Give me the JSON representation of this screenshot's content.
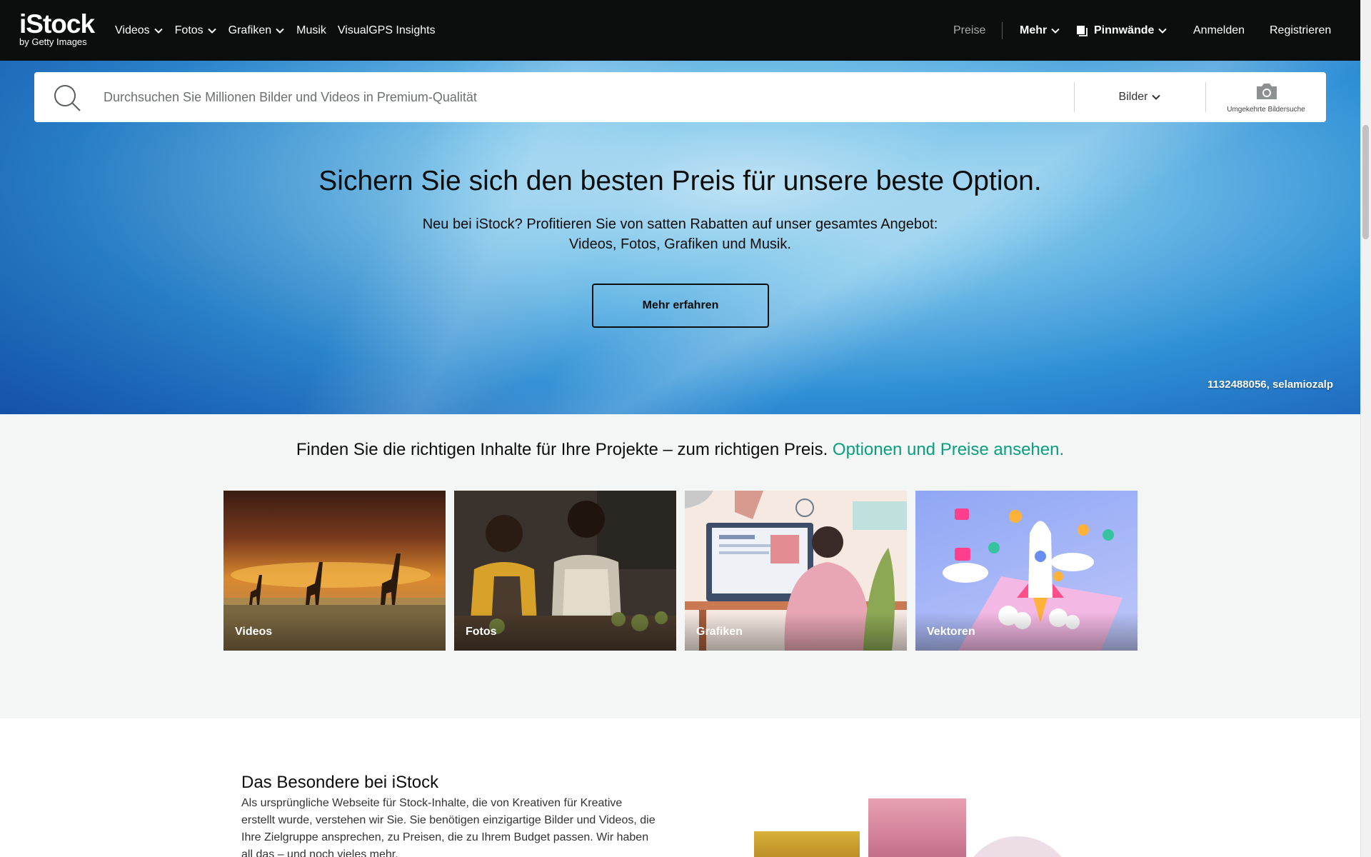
{
  "nav": {
    "logo": "iStock",
    "logo_sub": "by Getty Images",
    "left_items": [
      {
        "label": "Videos",
        "dropdown": true
      },
      {
        "label": "Fotos",
        "dropdown": true
      },
      {
        "label": "Grafiken",
        "dropdown": true
      },
      {
        "label": "Musik",
        "dropdown": false
      },
      {
        "label": "VisualGPS Insights",
        "dropdown": false
      }
    ],
    "preise": "Preise",
    "mehr": "Mehr",
    "pinnwaende": "Pinnwände",
    "anmelden": "Anmelden",
    "registrieren": "Registrieren"
  },
  "search": {
    "placeholder": "Durchsuchen Sie Millionen Bilder und Videos in Premium-Qualität",
    "type": "Bilder",
    "reverse_search": "Umgekehrte Bildersuche"
  },
  "hero": {
    "title": "Sichern Sie sich den besten Preis für unsere beste Option.",
    "subtitle_line1": "Neu bei iStock? Profitieren Sie von satten Rabatten auf unser gesamtes Angebot:",
    "subtitle_line2": "Videos, Fotos, Grafiken und Musik.",
    "button": "Mehr erfahren",
    "credit": "1132488056, selamiozalp"
  },
  "categories": {
    "intro": "Finden Sie die richtigen Inhalte für Ihre Projekte – zum richtigen Preis.",
    "intro_link": "Optionen und Preise ansehen.",
    "tiles": [
      "Videos",
      "Fotos",
      "Grafiken",
      "Vektoren"
    ]
  },
  "special": {
    "title": "Das Besondere bei iStock",
    "text": "Als ursprüngliche Webseite für Stock-Inhalte, die von Kreativen für Kreative erstellt wurde, verstehen wir Sie. Sie benötigen einzigartige Bilder und Videos, die Ihre Zielgruppe ansprechen, zu Preisen, die zu Ihrem Budget passen. Wir haben all das – und noch vieles mehr."
  },
  "colors": {
    "nav_bg": "#0c0d0d",
    "link_green": "#08a07d"
  }
}
